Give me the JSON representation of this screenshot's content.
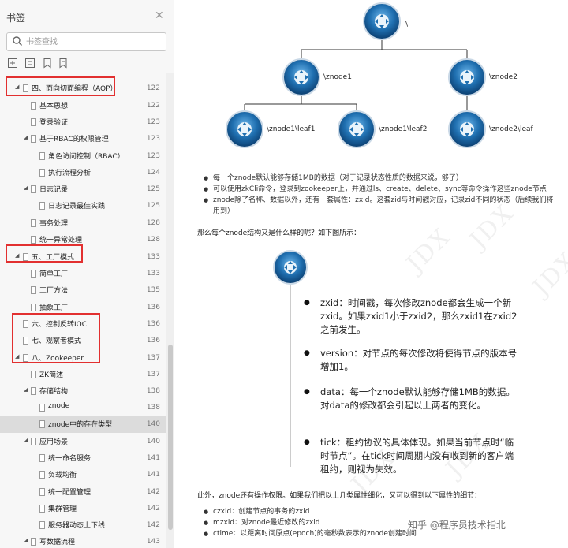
{
  "sidebar": {
    "title": "书签",
    "search_placeholder": "书签查找",
    "items": [
      {
        "label": "四、面向切面编程（AOP）",
        "page": "122"
      },
      {
        "label": "基本思想",
        "page": "122"
      },
      {
        "label": "登录验证",
        "page": "123"
      },
      {
        "label": "基于RBAC的权限管理",
        "page": "123"
      },
      {
        "label": "角色访问控制（RBAC）",
        "page": "123"
      },
      {
        "label": "执行流程分析",
        "page": "124"
      },
      {
        "label": "日志记录",
        "page": "125"
      },
      {
        "label": "日志记录最佳实践",
        "page": "125"
      },
      {
        "label": "事务处理",
        "page": "128"
      },
      {
        "label": "统一异常处理",
        "page": "128"
      },
      {
        "label": "五、工厂模式",
        "page": "133"
      },
      {
        "label": "简单工厂",
        "page": "133"
      },
      {
        "label": "工厂方法",
        "page": "135"
      },
      {
        "label": "抽象工厂",
        "page": "136"
      },
      {
        "label": "六、控制反转IOC",
        "page": "136"
      },
      {
        "label": "七、观察者模式",
        "page": "136"
      },
      {
        "label": "八、Zookeeper",
        "page": "137"
      },
      {
        "label": "ZK简述",
        "page": "137"
      },
      {
        "label": "存储结构",
        "page": "138"
      },
      {
        "label": "znode",
        "page": "138"
      },
      {
        "label": "znode中的存在类型",
        "page": "140"
      },
      {
        "label": "应用场景",
        "page": "140"
      },
      {
        "label": "统一命名服务",
        "page": "141"
      },
      {
        "label": "负载均衡",
        "page": "141"
      },
      {
        "label": "统一配置管理",
        "page": "142"
      },
      {
        "label": "集群管理",
        "page": "142"
      },
      {
        "label": "服务器动态上下线",
        "page": "142"
      },
      {
        "label": "写数据流程",
        "page": "143"
      }
    ]
  },
  "diagram": {
    "nodes": [
      {
        "label": "\\"
      },
      {
        "label": "\\znode1"
      },
      {
        "label": "\\znode2"
      },
      {
        "label": "\\znode1\\leaf1"
      },
      {
        "label": "\\znode1\\leaf2"
      },
      {
        "label": "\\znode2\\leaf"
      }
    ]
  },
  "content": {
    "bullets_top": [
      "每一个znode默认能够存储1MB的数据（对于记录状态性质的数据来说，够了）",
      "可以使用zkCli命令，登录到zookeeper上，并通过ls、create、delete、sync等命令操作这些znode节点",
      "znode除了名称、数据以外，还有一套属性：zxid。这套zid与时间戳对应，记录zid不同的状态（后续我们将",
      "用到）"
    ],
    "question": "那么每个znode结构又是什么样的呢？如下图所示：",
    "card_bullets": [
      "zxid：时间戳，每次修改znode都会生成一个新zxid。如果zxid1小于zxid2，那么zxid1在zxid2之前发生。",
      "version：对节点的每次修改将使得节点的版本号增加1。",
      "data：每一个znode默认能够存储1MB的数据。对data的修改都会引起以上两者的变化。",
      "tick：租约协议的具体体现。如果当前节点时“临时节点”。在tick时间周期内没有收到新的客户端租约，则视为失效。"
    ],
    "acl_para": "此外，znode还有操作权限。如果我们把以上几类属性细化，又可以得到以下属性的细节：",
    "bullets_bottom": [
      "czxid：创建节点的事务的zxid",
      "mzxid：对znode最近修改的zxid",
      "ctime：以距离时间原点(epoch)的毫秒数表示的znode创建时间"
    ],
    "watermark": "JDX",
    "footer_mark": "知乎 @程序员技术指北"
  },
  "colors": {
    "highlight_box": "#e23030",
    "node_blue": "#1f6fb0",
    "selected_row": "#dcdcdc"
  },
  "icons": [
    "search-icon",
    "close-icon",
    "expand-all-icon",
    "collapse-all-icon",
    "bookmark-add-icon",
    "bookmark-icon",
    "bookmark-node-icon"
  ]
}
